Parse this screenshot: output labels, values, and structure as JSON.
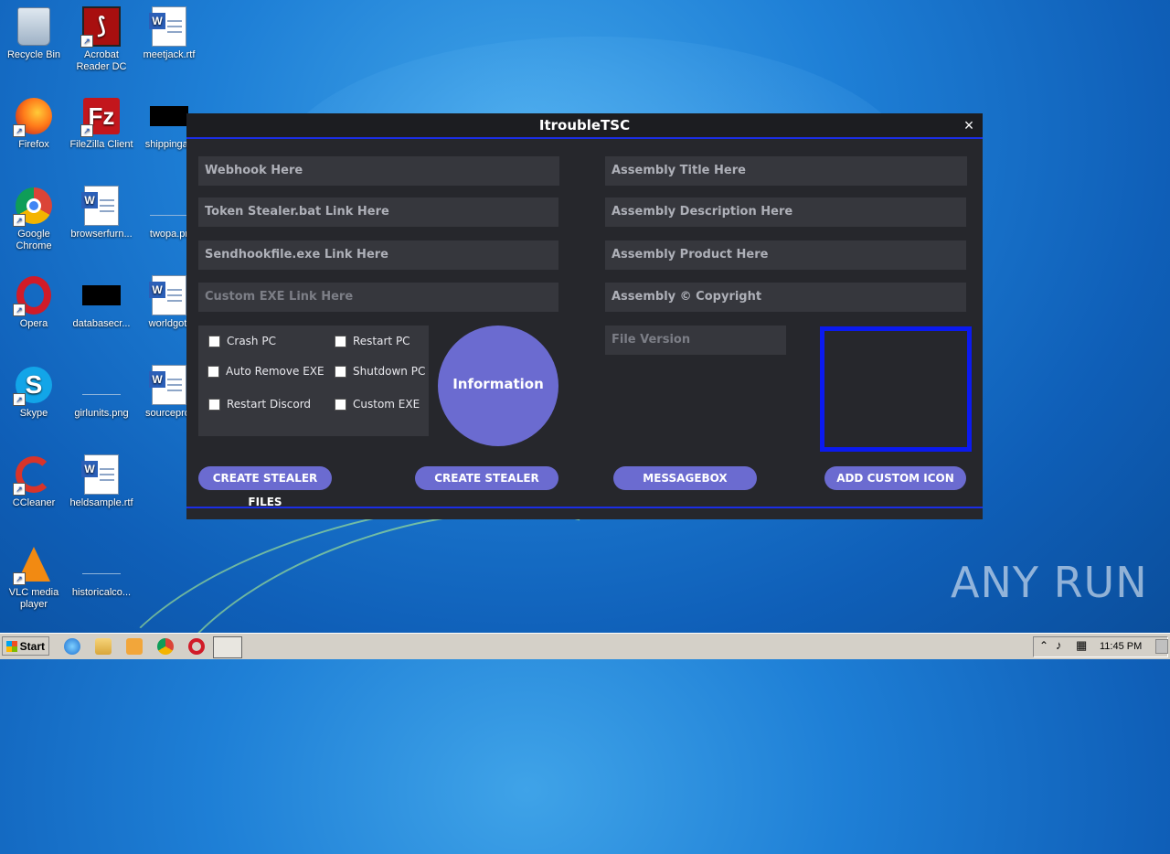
{
  "desktop": {
    "icons": [
      {
        "label": "Recycle Bin",
        "icon": "recycle-bin-icon"
      },
      {
        "label": "Acrobat Reader DC",
        "icon": "acrobat-icon"
      },
      {
        "label": "meetjack.rtf",
        "icon": "word-document-icon"
      },
      {
        "label": "Firefox",
        "icon": "firefox-icon"
      },
      {
        "label": "FileZilla Client",
        "icon": "filezilla-icon"
      },
      {
        "label": "shippingac",
        "icon": "black-file-icon"
      },
      {
        "label": "Google Chrome",
        "icon": "chrome-icon"
      },
      {
        "label": "browserfurn...",
        "icon": "word-document-icon"
      },
      {
        "label": "twopa.pr",
        "icon": "file-icon"
      },
      {
        "label": "Opera",
        "icon": "opera-icon"
      },
      {
        "label": "databasecr...",
        "icon": "black-file-icon"
      },
      {
        "label": "worldgot.",
        "icon": "word-document-icon"
      },
      {
        "label": "Skype",
        "icon": "skype-icon"
      },
      {
        "label": "girlunits.png",
        "icon": "image-file-icon"
      },
      {
        "label": "sourceprot",
        "icon": "word-document-icon"
      },
      {
        "label": "CCleaner",
        "icon": "ccleaner-icon"
      },
      {
        "label": "heldsample.rtf",
        "icon": "word-document-icon"
      },
      {
        "label": "VLC media player",
        "icon": "vlc-icon"
      },
      {
        "label": "historicalco...",
        "icon": "file-icon"
      }
    ],
    "watermark": "ANY RUN"
  },
  "window": {
    "title": "ItroubleTSC",
    "close_glyph": "×",
    "fields_left": [
      "Webhook Here",
      "Token Stealer.bat Link Here",
      "Sendhookfile.exe Link Here",
      "Custom EXE Link Here"
    ],
    "fields_right": [
      "Assembly Title Here",
      "Assembly Description Here",
      "Assembly Product Here",
      "Assembly © Copyright"
    ],
    "file_version": "File Version",
    "checkboxes": [
      {
        "label": "Crash PC",
        "checked": false
      },
      {
        "label": "Restart PC",
        "checked": false
      },
      {
        "label": "Auto Remove EXE",
        "checked": false
      },
      {
        "label": "Shutdown PC",
        "checked": false
      },
      {
        "label": "Restart Discord",
        "checked": false
      },
      {
        "label": "Custom EXE",
        "checked": false
      }
    ],
    "info_button": "Information",
    "buttons": [
      "CREATE STEALER FILES",
      "CREATE STEALER",
      "MESSAGEBOX",
      "ADD CUSTOM ICON"
    ],
    "colors": {
      "accent": "#6b6bd0",
      "border_blue": "#1b2ee6",
      "background": "#26272c",
      "field": "#36373d"
    }
  },
  "taskbar": {
    "start_label": "Start",
    "apps": [
      "internet-explorer-icon",
      "explorer-folder-icon",
      "media-player-icon",
      "chrome-icon",
      "opera-icon",
      "active-app-icon"
    ],
    "clock": "11:45 PM"
  }
}
